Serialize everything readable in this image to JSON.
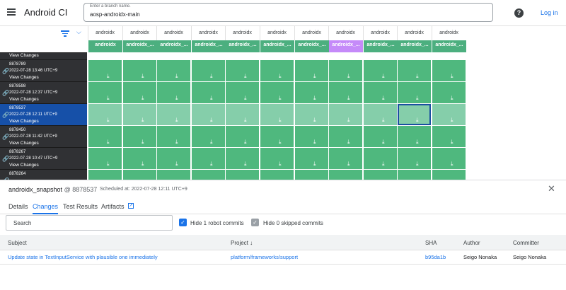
{
  "app": {
    "title": "Android CI",
    "branch_label": "Enter a branch name.",
    "branch_value": "aosp-androidx-main",
    "login": "Log in"
  },
  "columns": [
    "androidx",
    "androidx",
    "androidx",
    "androidx",
    "androidx",
    "androidx",
    "androidx",
    "androidx",
    "androidx",
    "androidx",
    "androidx"
  ],
  "targets": [
    "androidx",
    "androidx_...",
    "androidx_...",
    "androidx_...",
    "androidx_...",
    "androidx_...",
    "androidx_...",
    "androidx_...",
    "androidx_...",
    "androidx_...",
    "androidx_..."
  ],
  "builds": [
    {
      "id": "",
      "date": "",
      "view": "View Changes"
    },
    {
      "id": "8878789",
      "date": "2022-07-28 13:46 UTC+9",
      "view": "View Changes"
    },
    {
      "id": "8878598",
      "date": "2022-07-28 12:37 UTC+9",
      "view": "View Changes"
    },
    {
      "id": "8878537",
      "date": "2022-07-28 12:11 UTC+9",
      "view": "View Changes"
    },
    {
      "id": "8878450",
      "date": "2022-07-28 11:42 UTC+9",
      "view": "View Changes"
    },
    {
      "id": "8878267",
      "date": "2022-07-28 10:47 UTC+9",
      "view": "View Changes"
    },
    {
      "id": "8878264",
      "date": "",
      "view": ""
    }
  ],
  "panel": {
    "title": "androidx_snapshot",
    "at_build": "@ 8878537",
    "scheduled": "Scheduled at: 2022-07-28 12:11 UTC+9",
    "tabs": [
      "Details",
      "Changes",
      "Test Results",
      "Artifacts"
    ],
    "search_placeholder": "Search",
    "hide_robot": "Hide 1 robot commits",
    "hide_skipped": "Hide 0 skipped commits",
    "headers": {
      "subject": "Subject",
      "project": "Project ↓",
      "sha": "SHA",
      "author": "Author",
      "committer": "Committer"
    },
    "rows": [
      {
        "subject": "Update state in TextInputService with plausible one immediately",
        "project": "platform/frameworks/support",
        "sha": "b95da1b",
        "author": "Seigo Nonaka",
        "committer": "Seigo Nonaka"
      }
    ]
  },
  "colors": {
    "green": "#4fb87e",
    "light_green": "#85ceaa",
    "purple": "#c58af9",
    "selected_build": "#1650a8",
    "accent": "#1a73e8"
  }
}
